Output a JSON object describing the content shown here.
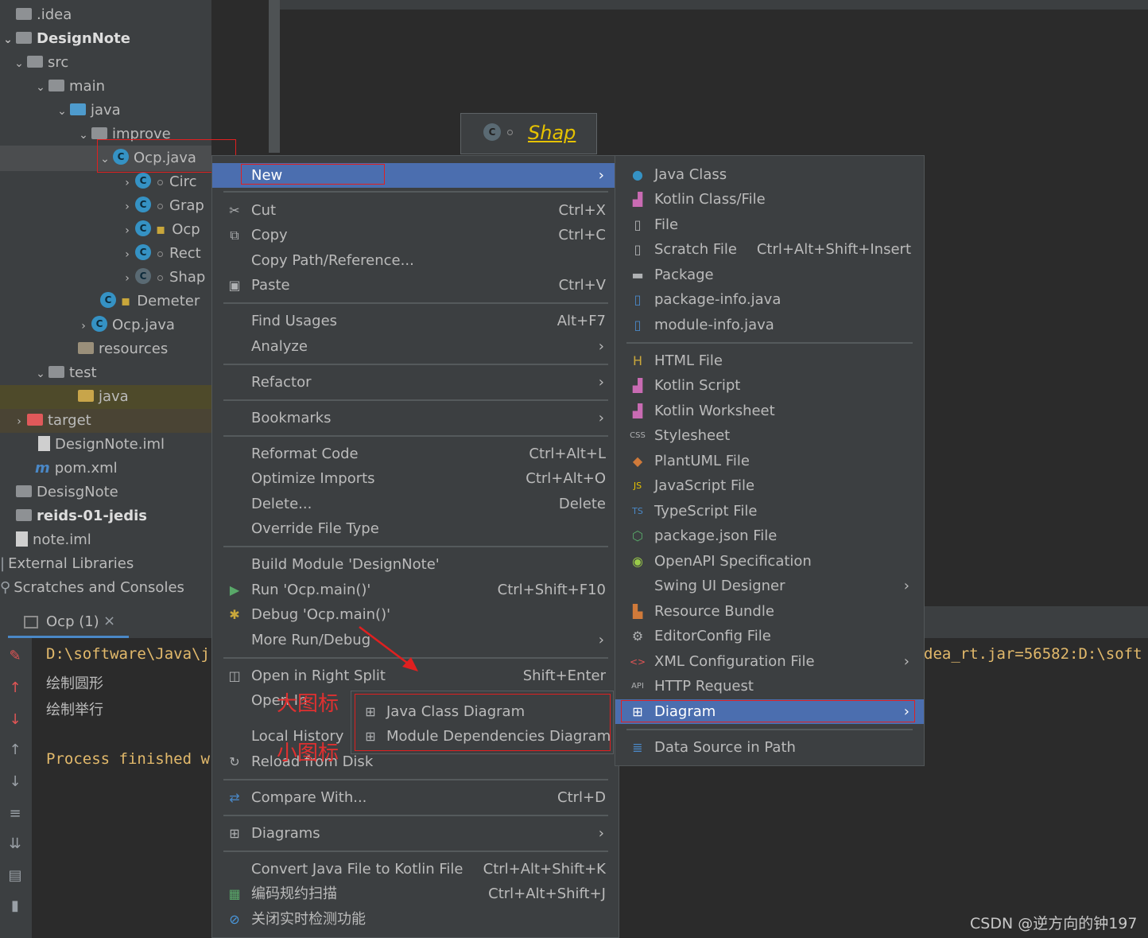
{
  "project_tree": {
    "items": [
      {
        "label": ".idea",
        "bold": false
      },
      {
        "label": "DesignNote",
        "bold": true
      },
      {
        "label": "src"
      },
      {
        "label": "main"
      },
      {
        "label": "java"
      },
      {
        "label": "improve"
      },
      {
        "label": "Ocp.java"
      },
      {
        "label": "Circ"
      },
      {
        "label": "Grap"
      },
      {
        "label": "Ocp"
      },
      {
        "label": "Rect"
      },
      {
        "label": "Shap"
      },
      {
        "label": "Demeter"
      },
      {
        "label": "Ocp.java"
      },
      {
        "label": "resources"
      },
      {
        "label": "test"
      },
      {
        "label": "java"
      },
      {
        "label": "target"
      },
      {
        "label": "DesignNote.iml"
      },
      {
        "label": "pom.xml"
      },
      {
        "label": "DesisgNote"
      },
      {
        "label": "reids-01-jedis"
      },
      {
        "label": "note.iml"
      },
      {
        "label": "External Libraries"
      },
      {
        "label": "Scratches and Consoles"
      }
    ]
  },
  "diagram": {
    "class_name": "Shap"
  },
  "console": {
    "tab_label": "Ocp (1)",
    "line1_left": "D:\\software\\Java\\j",
    "line1_right": "dea_rt.jar=56582:D:\\soft",
    "line2": "绘制圆形",
    "line3": "绘制举行",
    "line4": "Process finished w"
  },
  "context_menu": {
    "new": "New",
    "cut": "Cut",
    "cut_sc": "Ctrl+X",
    "copy": "Copy",
    "copy_sc": "Ctrl+C",
    "copy_path": "Copy Path/Reference...",
    "paste": "Paste",
    "paste_sc": "Ctrl+V",
    "find_usages": "Find Usages",
    "find_usages_sc": "Alt+F7",
    "analyze": "Analyze",
    "refactor": "Refactor",
    "bookmarks": "Bookmarks",
    "reformat": "Reformat Code",
    "reformat_sc": "Ctrl+Alt+L",
    "optimize": "Optimize Imports",
    "optimize_sc": "Ctrl+Alt+O",
    "delete": "Delete...",
    "delete_sc": "Delete",
    "override": "Override File Type",
    "build": "Build Module 'DesignNote'",
    "run": "Run 'Ocp.main()'",
    "run_sc": "Ctrl+Shift+F10",
    "debug": "Debug 'Ocp.main()'",
    "more_run": "More Run/Debug",
    "open_right": "Open in Right Split",
    "open_right_sc": "Shift+Enter",
    "open_in": "Open In",
    "local_history": "Local History",
    "reload": "Reload from Disk",
    "compare": "Compare With...",
    "compare_sc": "Ctrl+D",
    "diagrams": "Diagrams",
    "convert": "Convert Java File to Kotlin File",
    "convert_sc": "Ctrl+Alt+Shift+K",
    "scan": "编码规约扫描",
    "scan_sc": "Ctrl+Alt+Shift+J",
    "close_check": "关闭实时检测功能"
  },
  "new_menu": {
    "java_class": "Java Class",
    "kotlin_class": "Kotlin Class/File",
    "file": "File",
    "scratch": "Scratch File",
    "scratch_sc": "Ctrl+Alt+Shift+Insert",
    "package": "Package",
    "package_info": "package-info.java",
    "module_info": "module-info.java",
    "html": "HTML File",
    "kotlin_script": "Kotlin Script",
    "kotlin_worksheet": "Kotlin Worksheet",
    "stylesheet": "Stylesheet",
    "plantuml": "PlantUML File",
    "javascript": "JavaScript File",
    "typescript": "TypeScript File",
    "package_json": "package.json File",
    "openapi": "OpenAPI Specification",
    "swing": "Swing UI Designer",
    "resource_bundle": "Resource Bundle",
    "editorconfig": "EditorConfig File",
    "xml_config": "XML Configuration File",
    "http": "HTTP Request",
    "diagram": "Diagram",
    "datasource": "Data Source in Path"
  },
  "diagram_menu": {
    "java_class_diagram": "Java Class Diagram",
    "module_dep": "Module Dependencies Diagram"
  },
  "annotations": {
    "big_icon": "大图标",
    "small_icon": "小图标"
  },
  "watermark": "CSDN @逆方向的钟197",
  "colors": {
    "selection": "#4b6eaf",
    "annotation": "#e02020",
    "diagram_title": "#e6c200"
  }
}
